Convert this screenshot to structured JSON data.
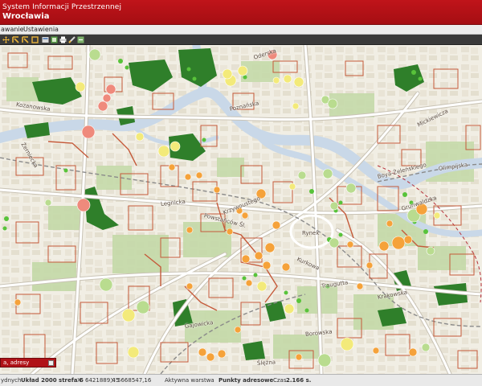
{
  "header": {
    "line1": "System Informacji Przestrzennej",
    "line2": "Wrocławia"
  },
  "menu": {
    "item1": "awanie",
    "item2": "Ustawienia"
  },
  "toolbar": {
    "icons": [
      "pan-icon",
      "zoom-in-icon",
      "zoom-out-icon",
      "zoom-extent-icon",
      "layers-icon",
      "legend-icon",
      "print-icon",
      "measure-icon",
      "export-icon"
    ]
  },
  "search": {
    "value": "a, adresy"
  },
  "status": {
    "coord_system_label": "ydnych",
    "coord_system": "Układ 2000 strefa 6",
    "x_label": "X:",
    "x_value": "6421889,45",
    "y_label": "Y:",
    "y_value": "5668547,16",
    "active_layer_label": "Aktywna warstwa",
    "active_layer": "Punkty adresowe",
    "time_label": "Czas",
    "time_value": "2.166 s."
  },
  "map_labels": {
    "oderska": "Oderska",
    "kozanowska": "Kozanowska",
    "zerniecka": "Żerniecka",
    "poznanska": "Poznańska",
    "legnicka": "Legnicka",
    "grunwaldzka": "Grunwaldzka",
    "rynek": "Rynek",
    "slezna": "Ślężna",
    "krzywoustego": "Krzywoustego",
    "mickiewicza": "Mickiewicza",
    "traugutta": "Traugutta",
    "sw_jerzego": "Kurkowa",
    "powstancow": "Powstańców Śl.",
    "bujwida": "Boya-Żeleńskiego",
    "olimpijska": "Olimpijska",
    "krakowska": "Krakowska",
    "borowska": "Borowska",
    "gajowicka": "Gajowicka"
  },
  "colors": {
    "header": "#b0141a",
    "river": "#c8d8ea",
    "forest": "#2f8a2a",
    "park": "#bcd5a0",
    "parcel_line": "#c05838",
    "road": "#ffffff"
  }
}
